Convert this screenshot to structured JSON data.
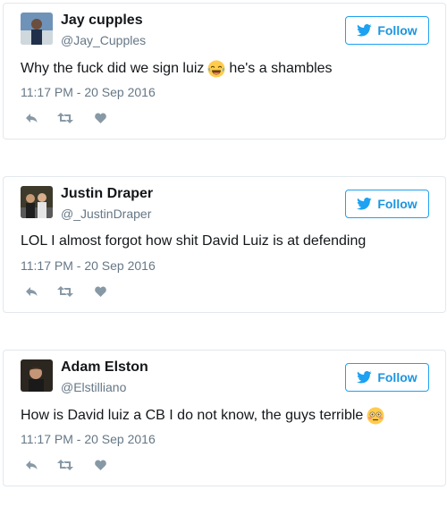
{
  "tweets": [
    {
      "name": "Jay cupples",
      "handle": "@Jay_Cupples",
      "follow_label": "Follow",
      "text_before": "Why the fuck did we sign luiz",
      "emoji": "tears-of-joy-emoji",
      "text_after": "he's a shambles",
      "time": "11:17 PM - 20 Sep 2016"
    },
    {
      "name": "Justin Draper",
      "handle": "@_JustinDraper",
      "follow_label": "Follow",
      "text_before": "LOL I almost forgot how shit David Luiz is at defending",
      "emoji": "",
      "text_after": "",
      "time": "11:17 PM - 20 Sep 2016"
    },
    {
      "name": "Adam Elston",
      "handle": "@Elstilliano",
      "follow_label": "Follow",
      "text_before": "How is David luiz a CB I do not know, the guys terrible",
      "emoji": "flushed-face-emoji",
      "text_after": "",
      "time": "11:17 PM - 20 Sep 2016"
    }
  ],
  "colors": {
    "follow_blue": "#1da1f2",
    "secondary_text": "#657786",
    "border": "#e1e8ed",
    "icon_gray": "#8899a6"
  },
  "icons": [
    "twitter-bird-icon",
    "reply-icon",
    "retweet-icon",
    "like-heart-icon"
  ]
}
